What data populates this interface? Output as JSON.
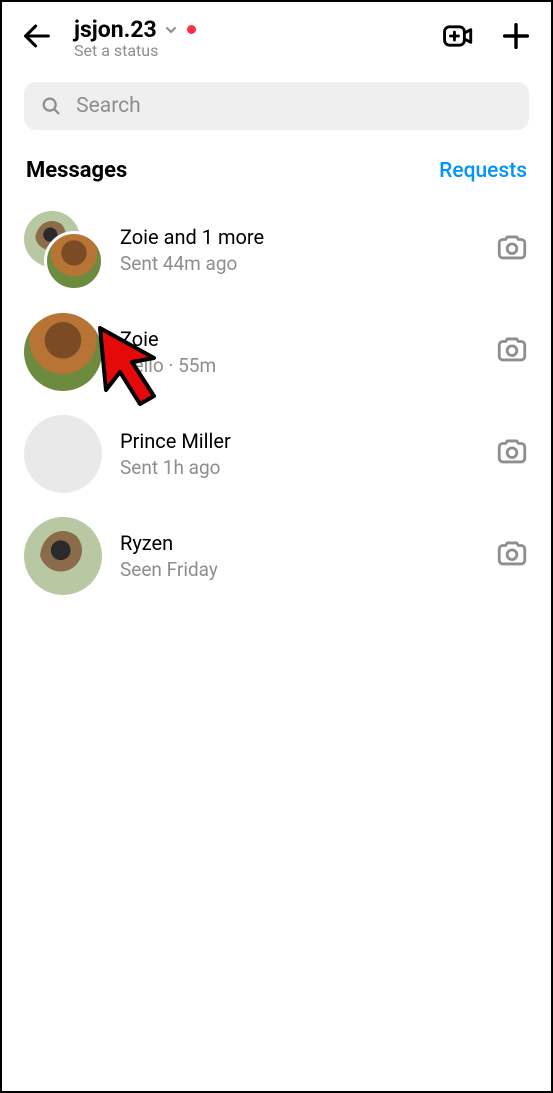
{
  "header": {
    "username": "jsjon.23",
    "status_text": "Set a status"
  },
  "search": {
    "placeholder": "Search"
  },
  "section": {
    "title": "Messages",
    "requests_label": "Requests"
  },
  "conversations": [
    {
      "name": "Zoie and 1 more",
      "subtitle": "Sent 44m ago",
      "avatar_type": "group"
    },
    {
      "name": "Zoie",
      "subtitle": "Hello · 55m",
      "avatar_type": "dogA"
    },
    {
      "name": "Prince Miller",
      "subtitle": "Sent 1h ago",
      "avatar_type": "blank"
    },
    {
      "name": "Ryzen",
      "subtitle": "Seen Friday",
      "avatar_type": "dogB"
    }
  ]
}
